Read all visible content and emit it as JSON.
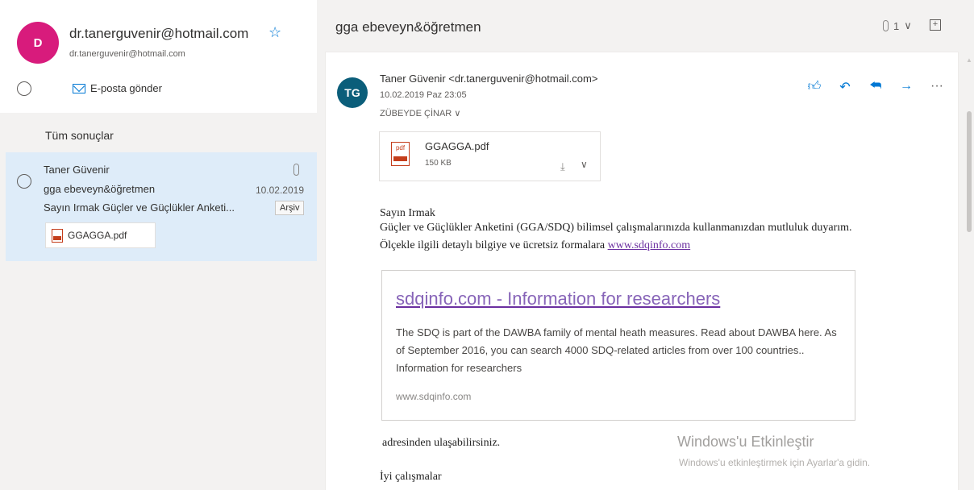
{
  "contact": {
    "avatar_letter": "D",
    "name": "dr.tanerguvenir@hotmail.com",
    "email": "dr.tanerguvenir@hotmail.com",
    "send_email_label": "E-posta gönder",
    "favorite_icon": "star-icon"
  },
  "results": {
    "header": "Tüm sonuçlar",
    "items": [
      {
        "sender": "Taner Güvenir",
        "subject": "gga ebeveyn&öğretmen",
        "date": "10.02.2019",
        "preview": "Sayın Irmak Güçler ve Güçlükler Anketi...",
        "archive_label": "Arşiv",
        "attachment": "GGAGGA.pdf"
      }
    ]
  },
  "reading": {
    "subject": "gga ebeveyn&öğretmen",
    "attachment_count": "1",
    "sender_initials": "TG",
    "from": "Taner Güvenir <dr.tanerguvenir@hotmail.com>",
    "sent": "10.02.2019 Paz 23:05",
    "recipient": "ZÜBEYDE ÇİNAR",
    "attachment": {
      "name": "GGAGGA.pdf",
      "size": "150 KB",
      "type_label": "pdf"
    },
    "body": {
      "greeting": "Sayın Irmak",
      "line1": "Güçler ve Güçlükler Anketini (GGA/SDQ) bilimsel çalışmalarınızda kullanmanızdan mutluluk duyarım.",
      "line2_text": "Ölçekle ilgili detaylı bilgiye ve ücretsiz formalara ",
      "link": "www.sdqinfo.com",
      "line3": "adresinden ulaşabilirsiniz.",
      "closing": "İyi çalışmalar"
    },
    "link_preview": {
      "title": "sdqinfo.com - Information for researchers",
      "description": "The SDQ is part of the DAWBA family of mental heath measures. Read about DAWBA here. As of September 2016, you can search 4000 SDQ-related articles from over 100 countries.. Information for researchers",
      "domain": "www.sdqinfo.com"
    }
  },
  "watermark": {
    "title": "Windows'u Etkinleştir",
    "subtitle": "Windows'u etkinleştirmek için Ayarlar'a gidin."
  },
  "colors": {
    "accent": "#0078d4",
    "avatar_d": "#d81b7c",
    "avatar_tg": "#0b5e7a",
    "selected_item": "#deecf9",
    "link": "#6b2fa0"
  }
}
